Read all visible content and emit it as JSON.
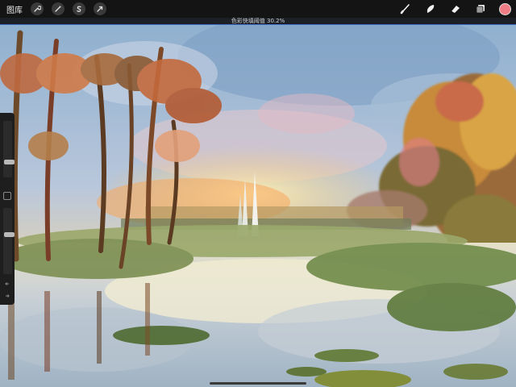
{
  "topbar": {
    "gallery_label": "图库",
    "left_tools": [
      {
        "name": "actions-wrench-icon"
      },
      {
        "name": "adjustments-wand-icon"
      },
      {
        "name": "selection-s-icon"
      },
      {
        "name": "transform-arrow-icon"
      }
    ],
    "right_tools": [
      {
        "name": "brush-icon"
      },
      {
        "name": "smudge-icon"
      },
      {
        "name": "eraser-icon"
      },
      {
        "name": "layers-icon"
      }
    ],
    "current_color": "#f07d86"
  },
  "status": {
    "message": "色彩快填阈值 30.2%",
    "threshold_percent": 30.2
  },
  "sidebar": {
    "brush_size_level": 0.25,
    "opacity_level": 0.6
  },
  "colors": {
    "toolbar_bg": "#141414",
    "accent": "#3d6fc4"
  }
}
